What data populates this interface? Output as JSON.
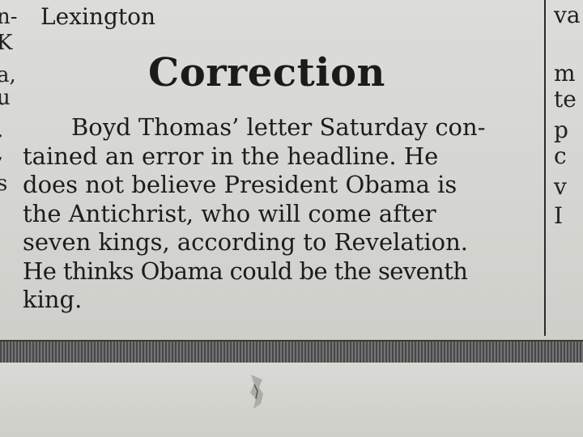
{
  "article": {
    "top_fragment": "Lexington",
    "headline": "Correction",
    "body_lines": [
      "Boyd Thomas’ letter Saturday con-",
      "tained an error in the headline. He",
      "does not believe President Obama is",
      "the Antichrist, who will come after",
      "seven kings, according to Revelation.",
      "He thinks Obama could be the seventh",
      "king."
    ]
  },
  "left_column_fragments": [
    "n-",
    "K",
    "a,",
    "u",
    ".",
    ",",
    "s"
  ],
  "right_column_fragments": [
    "va",
    "m",
    "te",
    "p",
    "c",
    "v",
    "I"
  ]
}
